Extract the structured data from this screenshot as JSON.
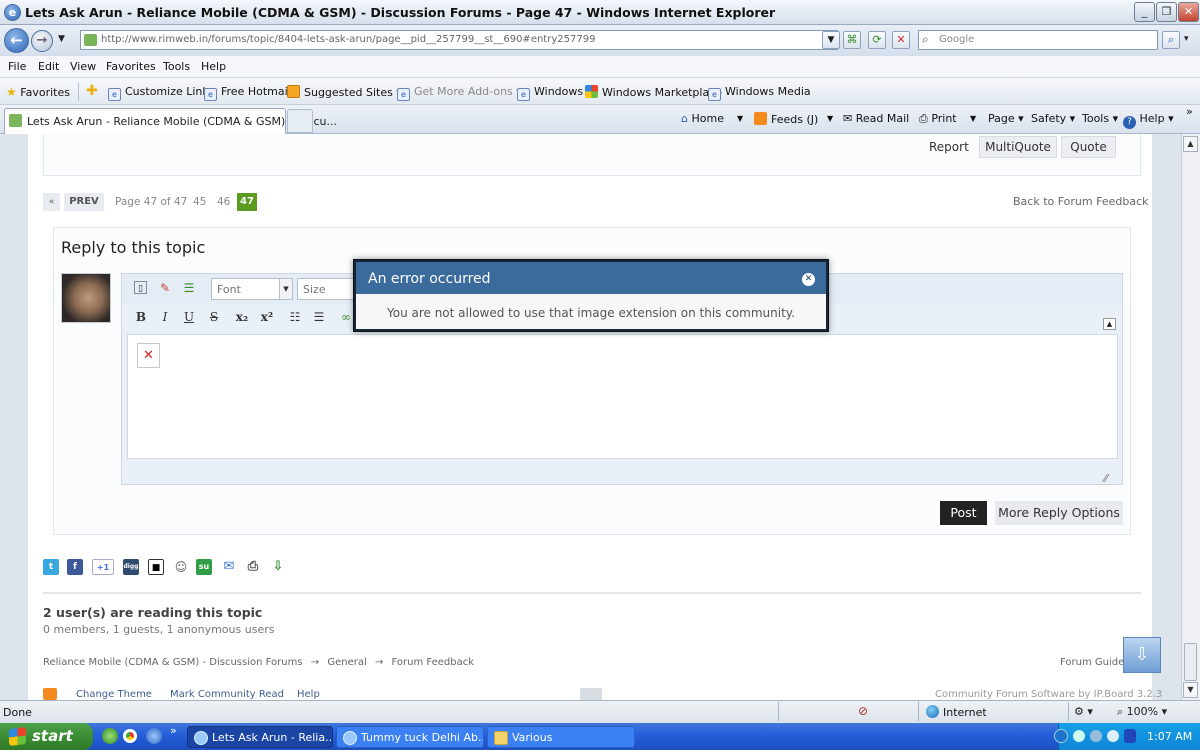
{
  "window": {
    "title": "Lets Ask Arun - Reliance Mobile (CDMA & GSM) - Discussion Forums - Page 47 - Windows Internet Explorer",
    "minimize": "_",
    "maximize": "❐",
    "close": "✕"
  },
  "address": {
    "url": "http://www.rimweb.in/forums/topic/8404-lets-ask-arun/page__pid__257799__st__690#entry257799",
    "search_placeholder": "Google"
  },
  "menu": [
    "File",
    "Edit",
    "View",
    "Favorites",
    "Tools",
    "Help"
  ],
  "favorites": {
    "label": "Favorites",
    "items": [
      "Customize Links",
      "Free Hotmail",
      "Suggested Sites ▾",
      "Get More Add-ons ▾",
      "Windows",
      "Windows Marketplace",
      "Windows Media"
    ]
  },
  "tab": {
    "label": "Lets Ask Arun - Reliance Mobile (CDMA & GSM) - Discu..."
  },
  "commands": [
    "Home",
    "Feeds (J)",
    "Read Mail",
    "Print",
    "Page ▾",
    "Safety ▾",
    "Tools ▾",
    "Help ▾"
  ],
  "post_actions": {
    "report": "Report",
    "multiquote": "MultiQuote",
    "quote": "Quote"
  },
  "pagination": {
    "prev_arrow": "«",
    "prev": "PREV",
    "page_info": "Page 47 of 47",
    "pages": [
      "45",
      "46"
    ],
    "current": "47",
    "back_link": "Back to Forum Feedback"
  },
  "reply": {
    "title": "Reply to this topic",
    "font_placeholder": "Font",
    "size_placeholder": "Size",
    "post": "Post",
    "more_options": "More Reply Options"
  },
  "dialog": {
    "title": "An error occurred",
    "message": "You are not allowed to use that image extension on this community."
  },
  "readers": {
    "title": "2 user(s) are reading this topic",
    "detail": "0 members, 1 guests, 1 anonymous users"
  },
  "breadcrumb": [
    "Reliance Mobile (CDMA & GSM) - Discussion Forums",
    "General",
    "Forum Feedback"
  ],
  "breadcrumb_sep": "→",
  "guidelines": "Forum Guidelines",
  "footer": {
    "change_theme": "Change Theme",
    "mark_read": "Mark Community Read",
    "help": "Help",
    "powered": "Community Forum Software by IP.Board 3.2.3"
  },
  "status": {
    "text": "Done",
    "zone": "Internet",
    "zoom": "100%"
  },
  "taskbar": {
    "start": "start",
    "tasks": [
      "Lets Ask Arun - Relia...",
      "Tummy tuck Delhi Ab...",
      "Various"
    ],
    "clock": "1:07 AM"
  }
}
